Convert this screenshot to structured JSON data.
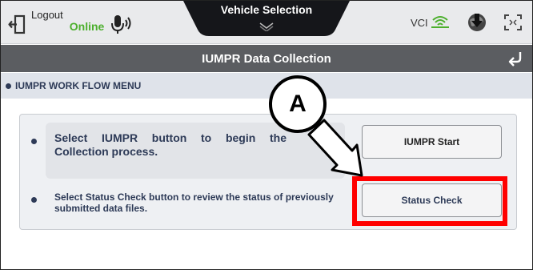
{
  "topbar": {
    "logout_label": "Logout",
    "status_label": "Online",
    "center_tab_title": "Vehicle Selection",
    "vci_label": "VCI",
    "icons": [
      "logout-icon",
      "microphone-icon",
      "chevron-down-icon",
      "wifi-icon",
      "globe-download-icon",
      "fullscreen-icon"
    ]
  },
  "titlebar": {
    "title": "IUMPR Data Collection",
    "back_icon": "back-arrow-icon"
  },
  "workflow": {
    "header": "IUMPR WORK FLOW MENU",
    "rows": [
      {
        "text": "Select IUMPR button to begin the Collection process.",
        "button_label": "IUMPR Start"
      },
      {
        "text": "Select Status Check button to review the status of previously submitted data files.",
        "button_label": "Status Check"
      }
    ]
  },
  "annotation": {
    "callout_letter": "A",
    "highlight_color": "#ff0000"
  },
  "colors": {
    "online_green": "#4caf2d",
    "titlebar_gray": "#5b5d61",
    "text_navy": "#2d3a57"
  }
}
